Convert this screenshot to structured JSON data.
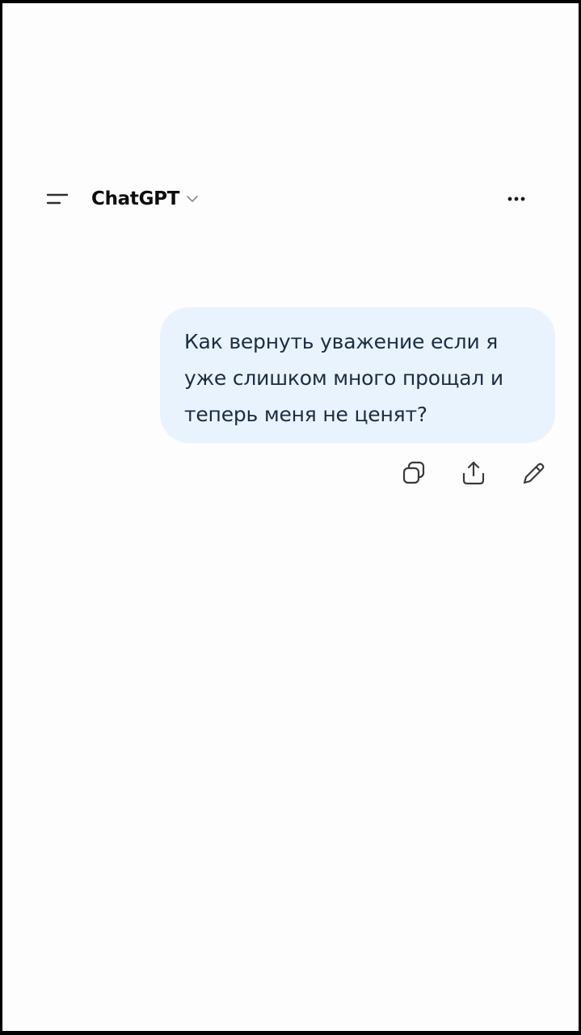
{
  "header": {
    "title": "ChatGPT",
    "menu_icon": "sidebar-menu-icon",
    "title_chevron_icon": "chevron-down-icon",
    "more_icon": "more-options-icon"
  },
  "conversation": {
    "user_message": "Как вернуть уважение если я уже слишком много прощал и теперь меня не ценят?"
  },
  "message_actions": {
    "copy_icon": "copy-icon",
    "share_icon": "share-icon",
    "edit_icon": "edit-pencil-icon"
  },
  "colors": {
    "background": "#fdfdfd",
    "bubble": "#e9f3fd",
    "bubble_text": "#1b2d44",
    "icon": "#3a3a3a"
  }
}
